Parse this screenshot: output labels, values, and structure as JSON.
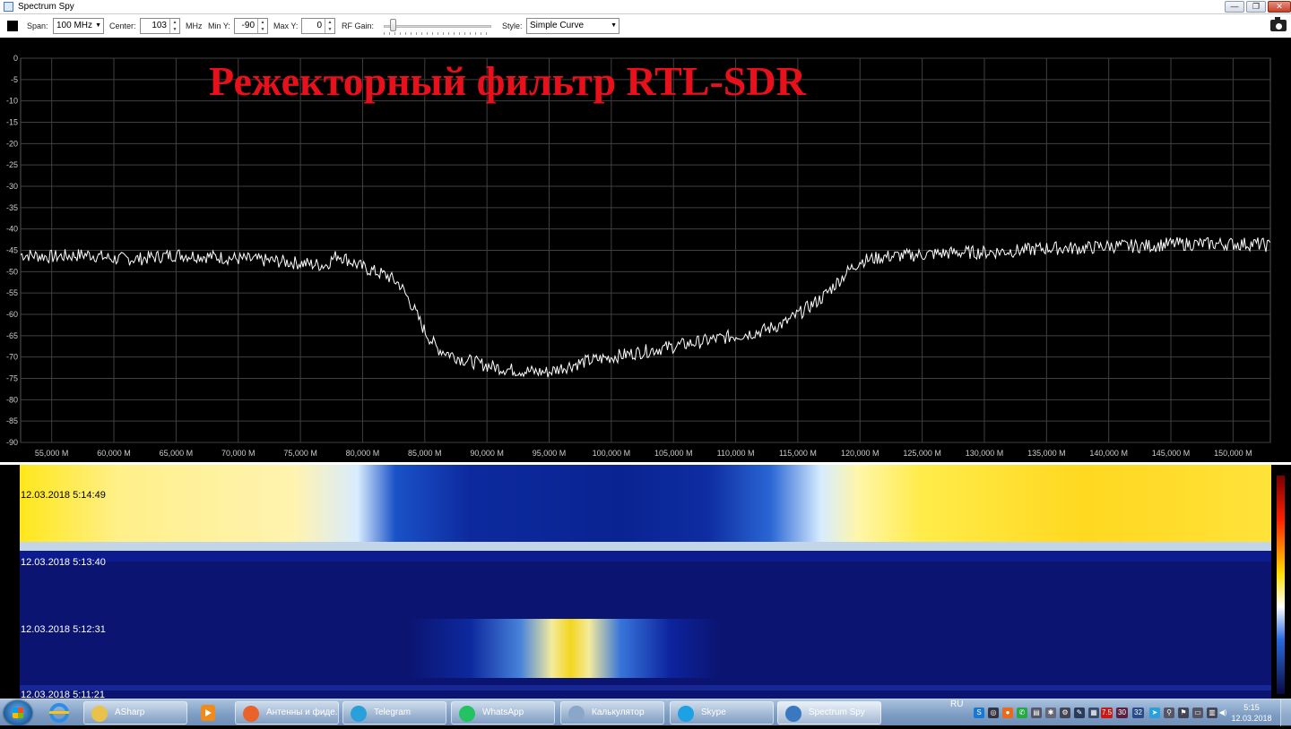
{
  "window": {
    "title": "Spectrum Spy",
    "buttons": {
      "minimize": "—",
      "restore": "❐",
      "close": "✕"
    }
  },
  "toolbar": {
    "span_label": "Span:",
    "span_value": "100 MHz",
    "center_label": "Center:",
    "center_value": "103",
    "center_unit": "MHz",
    "miny_label": "Min Y:",
    "miny_value": "-90",
    "maxy_label": "Max Y:",
    "maxy_value": "0",
    "rfgain_label": "RF Gain:",
    "rfgain_level": 0.08,
    "style_label": "Style:",
    "style_value": "Simple Curve",
    "icons": {
      "stop": "stop-icon",
      "screenshot": "camera-icon"
    }
  },
  "overlay_title": "Режекторный фильтр RTL-SDR",
  "chart_data": {
    "type": "line",
    "title": "",
    "xlabel": "",
    "ylabel": "",
    "xlim": [
      52.5,
      153.0
    ],
    "ylim": [
      -90,
      0
    ],
    "grid": true,
    "background": "#000000",
    "grid_color": "#404040",
    "line_color": "#ffffff",
    "y_ticks": [
      "0",
      "-5",
      "-10",
      "-15",
      "-20",
      "-25",
      "-30",
      "-35",
      "-40",
      "-45",
      "-50",
      "-55",
      "-60",
      "-65",
      "-70",
      "-75",
      "-80",
      "-85",
      "-90"
    ],
    "x_tick_values": [
      55,
      60,
      65,
      70,
      75,
      80,
      85,
      90,
      95,
      100,
      105,
      110,
      115,
      120,
      125,
      130,
      135,
      140,
      145,
      150
    ],
    "x_ticks": [
      "55,000 M",
      "60,000 M",
      "65,000 M",
      "70,000 M",
      "75,000 M",
      "80,000 M",
      "85,000 M",
      "90,000 M",
      "95,000 M",
      "100,000 M",
      "105,000 M",
      "110,000 M",
      "115,000 M",
      "120,000 M",
      "125,000 M",
      "130,000 M",
      "135,000 M",
      "140,000 M",
      "145,000 M",
      "150,000 M"
    ],
    "series": [
      {
        "x": [
          52.5,
          55,
          58,
          60,
          62,
          65,
          68,
          70,
          73,
          75,
          77,
          78,
          80,
          82,
          83,
          84,
          85,
          86,
          88,
          90,
          92,
          94,
          95,
          96,
          98,
          100,
          102,
          104,
          106,
          108,
          110,
          112,
          114,
          115,
          117,
          118,
          119,
          120,
          122,
          125,
          128,
          130,
          133,
          135,
          138,
          140,
          143,
          145,
          148,
          150,
          152,
          153
        ],
        "y": [
          -46,
          -46.5,
          -46,
          -47,
          -47,
          -46,
          -46.5,
          -47,
          -47.5,
          -48,
          -48.5,
          -46,
          -49,
          -51,
          -53,
          -58,
          -64,
          -68,
          -70.5,
          -72,
          -73,
          -73.5,
          -73.5,
          -72.5,
          -71,
          -70,
          -69,
          -68,
          -67,
          -66,
          -65,
          -64,
          -62,
          -60,
          -56,
          -53,
          -50,
          -47.5,
          -46.5,
          -46,
          -45.5,
          -45.5,
          -45,
          -44.5,
          -44.5,
          -44,
          -44,
          -43.5,
          -43.5,
          -43.5,
          -43.5,
          -44
        ]
      }
    ]
  },
  "waterfall": {
    "timestamps": [
      "12.03.2018 5:14:49",
      "12.03.2018 5:13:40",
      "12.03.2018 5:12:31",
      "12.03.2018 5:11:21"
    ]
  },
  "taskbar": {
    "items": [
      {
        "label": "ASharp",
        "color": "#e8c24a"
      },
      {
        "label": "Антенны и фиде...",
        "color": "#e8622a"
      },
      {
        "label": "Telegram",
        "color": "#2aa0da"
      },
      {
        "label": "WhatsApp",
        "color": "#25c263"
      },
      {
        "label": "Калькулятор",
        "color": "#8aa6c8"
      },
      {
        "label": "Skype",
        "color": "#1ea0e4"
      },
      {
        "label": "Spectrum Spy",
        "color": "#3a78c0"
      }
    ],
    "language": "RU",
    "tray_numbers": [
      "7.5",
      "30",
      "32"
    ],
    "clock_time": "5:15",
    "clock_date": "12.03.2018"
  }
}
